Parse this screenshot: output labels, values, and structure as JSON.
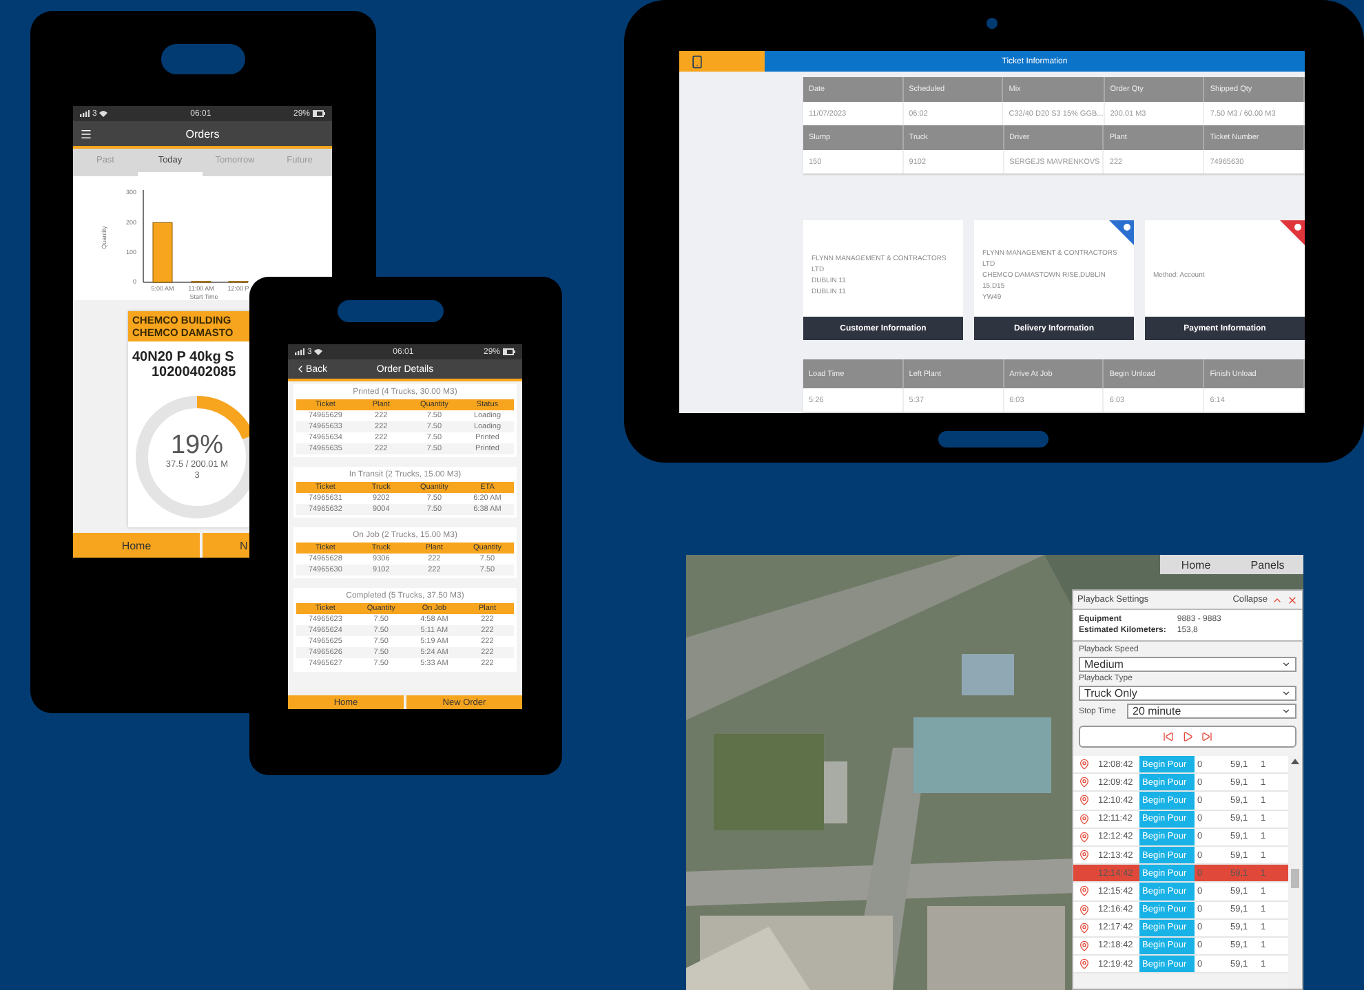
{
  "order_phone": {
    "status_bar": {
      "carrier": "3",
      "time": "06:01",
      "battery": "29%"
    },
    "title": "Orders",
    "tabs": [
      {
        "label": "Past",
        "selected": false
      },
      {
        "label": "Today",
        "selected": true
      },
      {
        "label": "Tomorrow",
        "selected": false
      },
      {
        "label": "Future",
        "selected": false
      }
    ],
    "chart_data": {
      "type": "bar",
      "xlabel": "Start Time",
      "ylabel": "Quantity",
      "categories": [
        "5:00 AM",
        "11:00 AM",
        "12:00 P"
      ],
      "values": [
        200,
        3,
        3
      ],
      "ylim": [
        0,
        300
      ],
      "yticks": [
        0,
        100,
        200,
        300
      ]
    },
    "order_card": {
      "customer_lines": [
        "CHEMCO BUILDING",
        "CHEMCO DAMASTO"
      ],
      "product_lines": [
        "40N20 P 40kg S",
        "10200402085"
      ],
      "progress": {
        "percent": "19%",
        "quantity": "37.5 / 200.01 M",
        "count": "3",
        "level": 0.19
      }
    },
    "footer_buttons": [
      "Home",
      "N"
    ]
  },
  "details_phone": {
    "status_bar": {
      "carrier": "3",
      "time": "06:01",
      "battery": "29%"
    },
    "back": "Back",
    "title": "Order Details",
    "sections": [
      {
        "title": "Printed (4 Trucks, 30.00 M3)",
        "columns": [
          "Ticket",
          "Plant",
          "Quantity",
          "Status"
        ],
        "rows": [
          [
            "74965629",
            "222",
            "7.50",
            "Loading"
          ],
          [
            "74965633",
            "222",
            "7.50",
            "Loading"
          ],
          [
            "74965634",
            "222",
            "7.50",
            "Printed"
          ],
          [
            "74965635",
            "222",
            "7.50",
            "Printed"
          ]
        ]
      },
      {
        "title": "In Transit (2 Trucks, 15.00 M3)",
        "columns": [
          "Ticket",
          "Truck",
          "Quantity",
          "ETA"
        ],
        "rows": [
          [
            "74965631",
            "9202",
            "7.50",
            "6:20 AM"
          ],
          [
            "74965632",
            "9004",
            "7.50",
            "6:38 AM"
          ]
        ]
      },
      {
        "title": "On Job (2 Trucks, 15.00 M3)",
        "columns": [
          "Ticket",
          "Truck",
          "Plant",
          "Quantity"
        ],
        "rows": [
          [
            "74965628",
            "9306",
            "222",
            "7.50"
          ],
          [
            "74965630",
            "9102",
            "222",
            "7.50"
          ]
        ]
      },
      {
        "title": "Completed (5 Trucks, 37.50 M3)",
        "columns": [
          "Ticket",
          "Quantity",
          "On Job",
          "Plant"
        ],
        "rows": [
          [
            "74965623",
            "7.50",
            "4:58 AM",
            "222"
          ],
          [
            "74965624",
            "7.50",
            "5:11 AM",
            "222"
          ],
          [
            "74965625",
            "7.50",
            "5:19 AM",
            "222"
          ],
          [
            "74965626",
            "7.50",
            "5:24 AM",
            "222"
          ],
          [
            "74965627",
            "7.50",
            "5:33 AM",
            "222"
          ]
        ]
      }
    ],
    "footer_buttons": [
      "Home",
      "New Order"
    ]
  },
  "tablet": {
    "title": "Ticket Information",
    "ticket_tables": [
      {
        "columns": [
          "Date",
          "Scheduled",
          "Mix",
          "Order Qty",
          "Shipped Qty"
        ],
        "values": [
          "11/07/2023",
          "06:02",
          "C32/40 D20 S3 15% GGB...",
          "200.01 M3",
          "7.50 M3 / 60.00 M3"
        ]
      },
      {
        "columns": [
          "Slump",
          "Truck",
          "Driver",
          "Plant",
          "Ticket Number"
        ],
        "values": [
          "150",
          "9102",
          "SERGEJS MAVRENKOVS",
          "222",
          "74965630"
        ]
      }
    ],
    "info_cards": [
      {
        "lines": [
          "FLYNN MANAGEMENT & CONTRACTORS LTD",
          "DUBLIN 11",
          "DUBLIN 11"
        ],
        "button": "Customer Information"
      },
      {
        "lines": [
          "FLYNN MANAGEMENT & CONTRACTORS LTD",
          "CHEMCO DAMASTOWN RISE,DUBLIN 15,D15",
          "YW49"
        ],
        "button": "Delivery Information",
        "color": "#2b6fd0"
      },
      {
        "lines": [
          "Method: Account"
        ],
        "button": "Payment Information",
        "color": "#e0353a"
      }
    ],
    "times_table": {
      "columns": [
        "Load Time",
        "Left Plant",
        "Arrive At Job",
        "Begin Unload",
        "Finish Unload"
      ],
      "values": [
        "5:26",
        "5:37",
        "6:03",
        "6:03",
        "6:14"
      ]
    }
  },
  "playback": {
    "tabs": [
      "Home",
      "Panels"
    ],
    "title": "Playback Settings",
    "collapse": "Collapse",
    "info": [
      {
        "label": "Equipment",
        "value": "9883 - 9883"
      },
      {
        "label": "Estimated Kilometers:",
        "value": "153,8"
      }
    ],
    "speed_label": "Playback Speed",
    "speed": "Medium",
    "type_label": "Playback Type",
    "type": "Truck Only",
    "stop_label": "Stop Time",
    "stop": "20 minute",
    "events": [
      {
        "time": "12:08:42",
        "status": "Begin Pour",
        "column_3": "0",
        "column_4": "59,1",
        "column_5": "1",
        "selected": false
      },
      {
        "time": "12:09:42",
        "status": "Begin Pour",
        "column_3": "0",
        "column_4": "59,1",
        "column_5": "1",
        "selected": false
      },
      {
        "time": "12:10:42",
        "status": "Begin Pour",
        "column_3": "0",
        "column_4": "59,1",
        "column_5": "1",
        "selected": false
      },
      {
        "time": "12:11:42",
        "status": "Begin Pour",
        "column_3": "0",
        "column_4": "59,1",
        "column_5": "1",
        "selected": false
      },
      {
        "time": "12:12:42",
        "status": "Begin Pour",
        "column_3": "0",
        "column_4": "59,1",
        "column_5": "1",
        "selected": false
      },
      {
        "time": "12:13:42",
        "status": "Begin Pour",
        "column_3": "0",
        "column_4": "59,1",
        "column_5": "1",
        "selected": false
      },
      {
        "time": "12:14:42",
        "status": "Begin Pour",
        "column_3": "0",
        "column_4": "59,1",
        "column_5": "1",
        "selected": true
      },
      {
        "time": "12:15:42",
        "status": "Begin Pour",
        "column_3": "0",
        "column_4": "59,1",
        "column_5": "1",
        "selected": false
      },
      {
        "time": "12:16:42",
        "status": "Begin Pour",
        "column_3": "0",
        "column_4": "59,1",
        "column_5": "1",
        "selected": false
      },
      {
        "time": "12:17:42",
        "status": "Begin Pour",
        "column_3": "0",
        "column_4": "59,1",
        "column_5": "1",
        "selected": false
      },
      {
        "time": "12:18:42",
        "status": "Begin Pour",
        "column_3": "0",
        "column_4": "59,1",
        "column_5": "1",
        "selected": false
      },
      {
        "time": "12:19:42",
        "status": "Begin Pour",
        "column_3": "0",
        "column_4": "59,1",
        "column_5": "1",
        "selected": false
      }
    ]
  }
}
